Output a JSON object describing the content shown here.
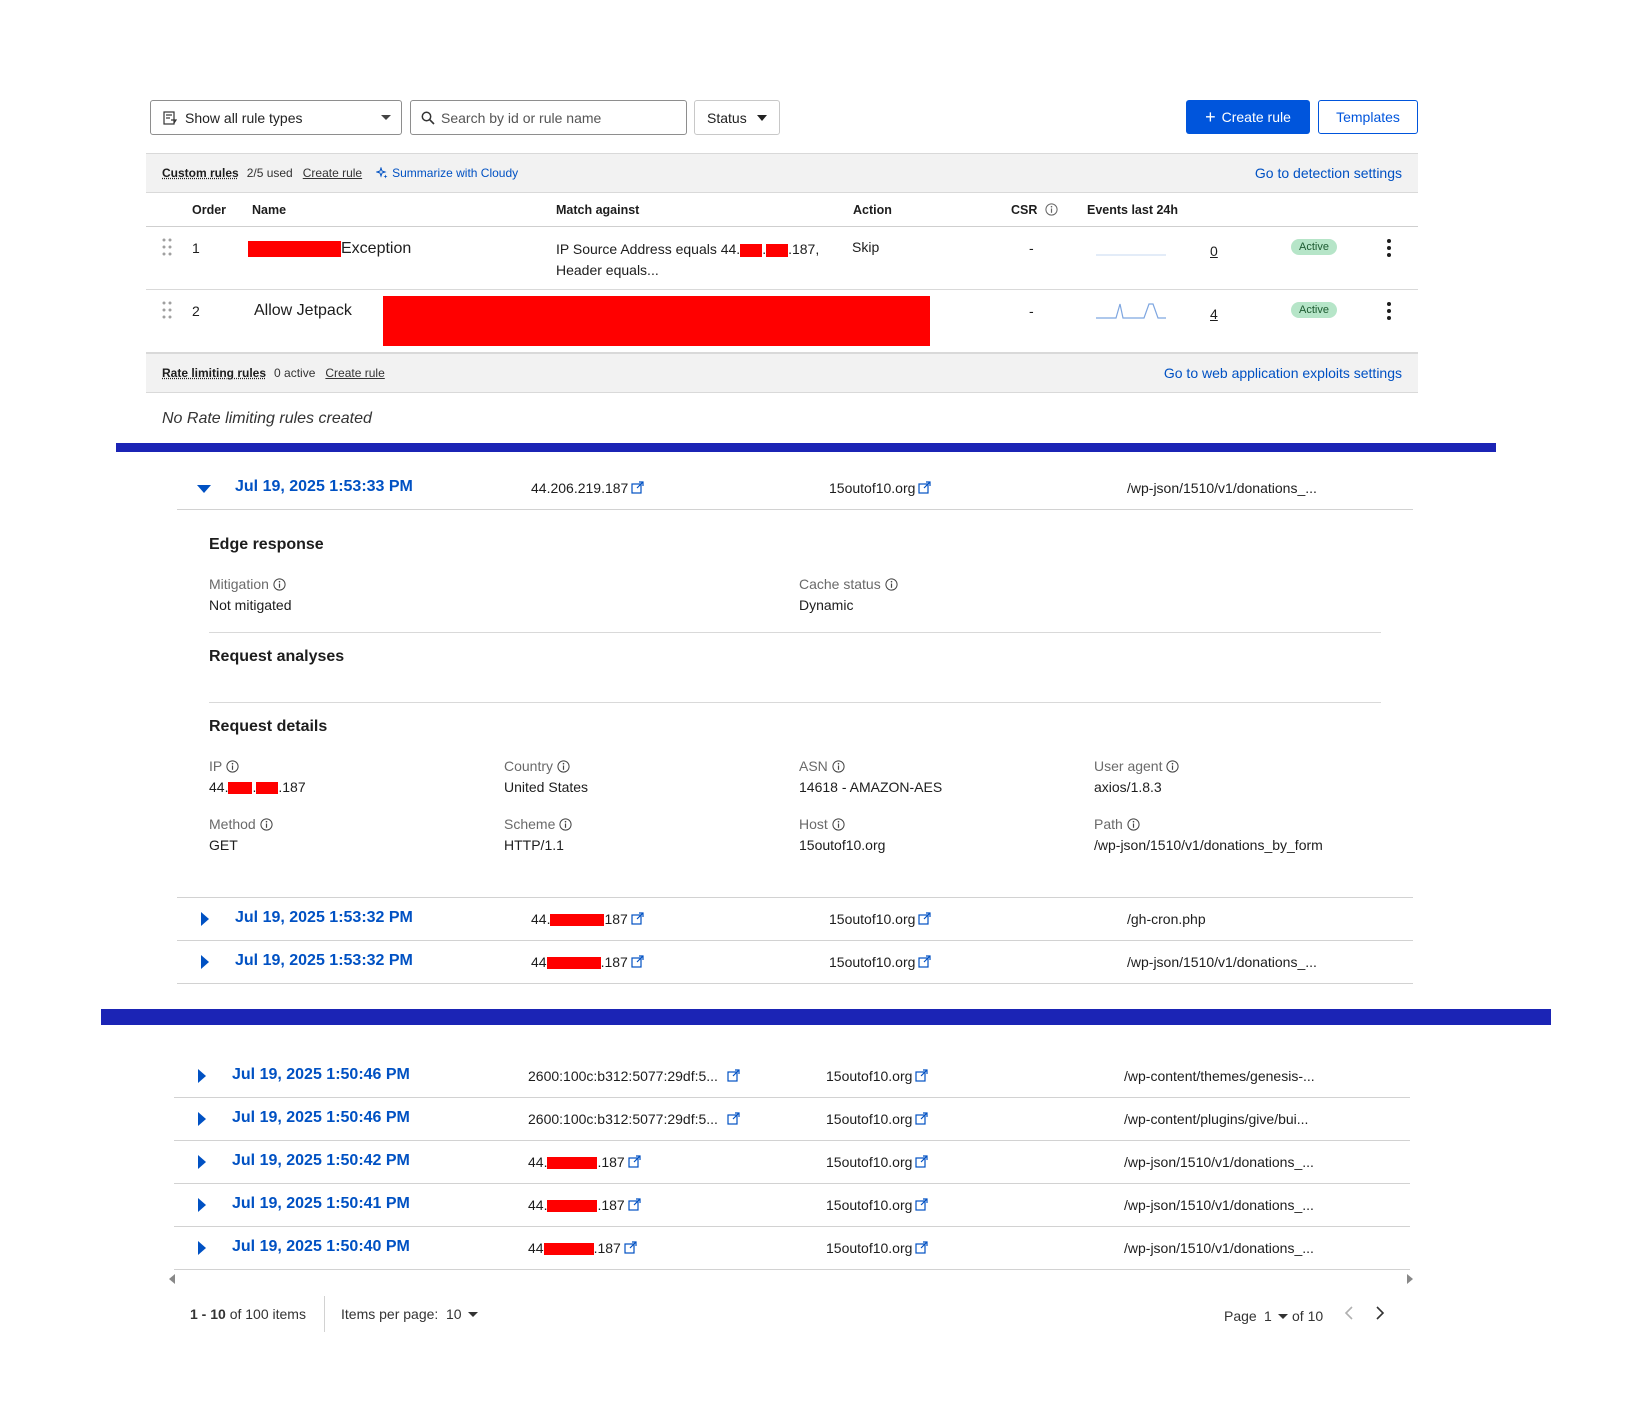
{
  "toolbar": {
    "rule_type_select": "Show all rule types",
    "search_placeholder": "Search by id or rule name",
    "status_label": "Status",
    "create_rule_label": "Create rule",
    "templates_label": "Templates"
  },
  "custom_rules": {
    "title": "Custom rules",
    "used": "2/5 used",
    "create_rule": "Create rule",
    "summarize": "Summarize with Cloudy",
    "settings_link": "Go to detection settings",
    "columns": {
      "order": "Order",
      "name": "Name",
      "match": "Match against",
      "action": "Action",
      "csr": "CSR",
      "events": "Events last 24h"
    },
    "rows": [
      {
        "order": "1",
        "name_suffix": "Exception",
        "match_prefix": "IP Source Address equals 44.",
        "match_dot": ".",
        "match_suffix": ".187,",
        "match_line2": "Header equals...",
        "action": "Skip",
        "csr": "-",
        "events": "0",
        "status": "Active"
      },
      {
        "order": "2",
        "name": "Allow Jetpack",
        "csr": "-",
        "events": "4",
        "status": "Active"
      }
    ]
  },
  "rate_limiting": {
    "title": "Rate limiting rules",
    "active": "0 active",
    "create_rule": "Create rule",
    "settings_link": "Go to web application exploits settings",
    "empty": "No Rate limiting rules created"
  },
  "events_top": [
    {
      "datetime": "Jul 19, 2025 1:53:33 PM",
      "ip": "44.206.219.187",
      "host": "15outof10.org",
      "path": "/wp-json/1510/v1/donations_..."
    },
    {
      "datetime": "Jul 19, 2025 1:53:32 PM",
      "ip_prefix": "44.",
      "ip_suffix": "187",
      "host": "15outof10.org",
      "path": "/gh-cron.php"
    },
    {
      "datetime": "Jul 19, 2025 1:53:32 PM",
      "ip_prefix": "44",
      "ip_suffix": ".187",
      "host": "15outof10.org",
      "path": "/wp-json/1510/v1/donations_..."
    }
  ],
  "details": {
    "edge_response": "Edge response",
    "mitigation_label": "Mitigation",
    "mitigation_value": "Not mitigated",
    "cache_label": "Cache status",
    "cache_value": "Dynamic",
    "request_analyses": "Request analyses",
    "request_details": "Request details",
    "ip_label": "IP",
    "ip_prefix": "44.",
    "ip_dot": ".",
    "ip_suffix": ".187",
    "country_label": "Country",
    "country_value": "United States",
    "asn_label": "ASN",
    "asn_value": "14618 - AMAZON-AES",
    "ua_label": "User agent",
    "ua_value": "axios/1.8.3",
    "method_label": "Method",
    "method_value": "GET",
    "scheme_label": "Scheme",
    "scheme_value": "HTTP/1.1",
    "host_label": "Host",
    "host_value": "15outof10.org",
    "path_label": "Path",
    "path_value": "/wp-json/1510/v1/donations_by_form"
  },
  "events_bottom": [
    {
      "datetime": "Jul 19, 2025 1:50:46 PM",
      "ip": "2600:100c:b312:5077:29df:5...",
      "host": "15outof10.org",
      "path": "/wp-content/themes/genesis-..."
    },
    {
      "datetime": "Jul 19, 2025 1:50:46 PM",
      "ip": "2600:100c:b312:5077:29df:5...",
      "host": "15outof10.org",
      "path": "/wp-content/plugins/give/bui..."
    },
    {
      "datetime": "Jul 19, 2025 1:50:42 PM",
      "ip_prefix": "44.",
      "ip_suffix": ".187",
      "host": "15outof10.org",
      "path": "/wp-json/1510/v1/donations_..."
    },
    {
      "datetime": "Jul 19, 2025 1:50:41 PM",
      "ip_prefix": "44.",
      "ip_suffix": ".187",
      "host": "15outof10.org",
      "path": "/wp-json/1510/v1/donations_..."
    },
    {
      "datetime": "Jul 19, 2025 1:50:40 PM",
      "ip_prefix": "44",
      "ip_suffix": ".187",
      "host": "15outof10.org",
      "path": "/wp-json/1510/v1/donations_..."
    }
  ],
  "pagination": {
    "range": "1 - 10",
    "of_items": "of 100 items",
    "per_page_label": "Items per page:",
    "per_page_value": "10",
    "page_label": "Page",
    "page_value": "1",
    "of_pages": "of 10"
  },
  "colors": {
    "accent": "#0051c3",
    "primary_button": "#0055dc",
    "separator": "#1b24b5",
    "redaction": "#ff0000",
    "active_badge": "#b6e5c8"
  }
}
